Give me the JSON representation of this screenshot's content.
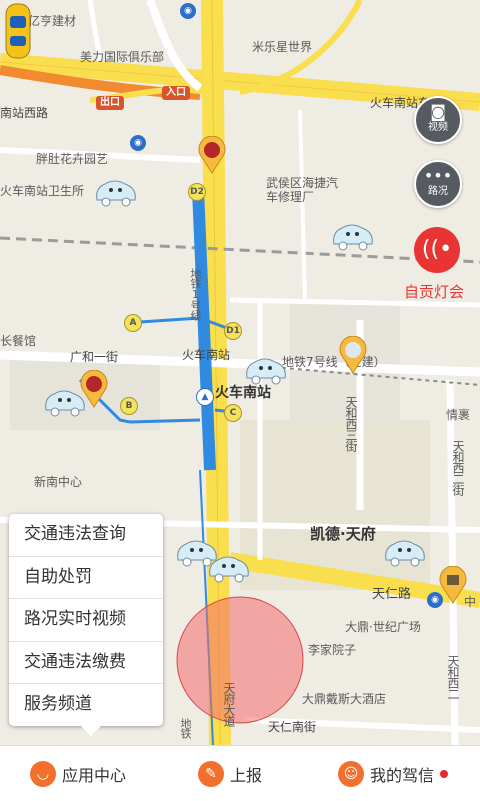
{
  "map": {
    "pois": {
      "yiheng": "亿亨建材",
      "meili": "美力国际俱乐部",
      "mixing": "米乐星世界",
      "pangdu": "胖肚花卉园艺",
      "weisheng": "火车南站卫生所",
      "wuhou": "武侯区海捷汽车修理厂",
      "xinnan": "新南中心",
      "qinghe": "情裹",
      "lijia": "李家院子",
      "dading_shiji": "大鼎·世纪广场",
      "dading_hotel": "大鼎戴斯大酒店",
      "canguan": "长餐馆",
      "tianren_nan": "天仁南街",
      "kaide": "凯德·天府",
      "zhong": "中",
      "zhongrui": "中瑞"
    },
    "roads": {
      "huochenan_xi": "南站西路",
      "huochenan_east": "火车南站东",
      "guanghe": "广和一街",
      "huochenan_station": "火车南站",
      "subway7": "地铁7号线（在建）",
      "tianren": "天仁路",
      "tianfu_west": "天和西三街",
      "tianhe_er": "天和西二街",
      "tianhe_er2": "天和西二",
      "tianfu_dadao": "天府大道",
      "metro_line1": "地铁1号线",
      "ditie": "地铁"
    },
    "markers": {
      "exit": "出口",
      "entry": "入口",
      "d2": "D2",
      "d1": "D1",
      "a": "A",
      "b": "B",
      "c": "C"
    },
    "buttons": {
      "video": "视频",
      "traffic": "路况",
      "live": "自贡灯会"
    }
  },
  "menu": {
    "items": [
      "交通违法查询",
      "自助处罚",
      "路况实时视频",
      "交通违法缴费",
      "服务频道"
    ]
  },
  "tabbar": {
    "app_center": "应用中心",
    "report": "上报",
    "my_driving": "我的驾信"
  },
  "colors": {
    "accent": "#f36f2e",
    "highway": "#f9de4d",
    "metro_line": "#2f8ae0",
    "alert": "#e93434"
  }
}
